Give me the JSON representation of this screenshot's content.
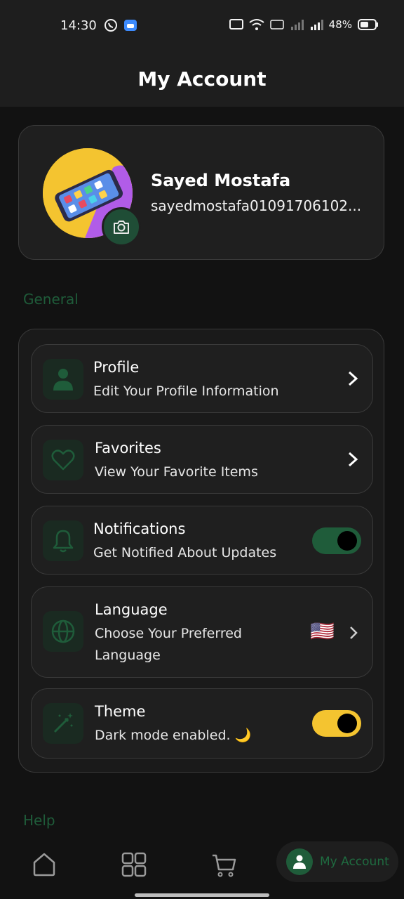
{
  "status_bar": {
    "time": "14:30",
    "battery": "48%"
  },
  "header": {
    "title": "My Account"
  },
  "profile": {
    "name": "Sayed Mostafa",
    "email": "sayedmostafa01091706102..."
  },
  "sections": {
    "general": "General",
    "help": "Help"
  },
  "settings": [
    {
      "title": "Profile",
      "subtitle": "Edit Your Profile Information",
      "icon": "person-icon",
      "control": "chevron"
    },
    {
      "title": "Favorites",
      "subtitle": "View Your Favorite Items",
      "icon": "heart-icon",
      "control": "chevron"
    },
    {
      "title": "Notifications",
      "subtitle": "Get Notified About Updates",
      "icon": "bell-icon",
      "control": "toggle",
      "toggle_on": true,
      "toggle_color": "#1f5c3a"
    },
    {
      "title": "Language",
      "subtitle": "Choose Your Preferred Language",
      "icon": "globe-icon",
      "control": "flag-chevron",
      "flag": "🇺🇸"
    },
    {
      "title": "Theme",
      "subtitle": "Dark mode enabled. 🌙",
      "icon": "magic-wand-icon",
      "control": "toggle",
      "toggle_on": true,
      "toggle_color": "#f4c430"
    }
  ],
  "bottom_nav": {
    "items": [
      "home-icon",
      "grid-icon",
      "cart-icon"
    ],
    "active_label": "My Account"
  },
  "colors": {
    "accent_green": "#1f5c3a",
    "accent_yellow": "#f4c430",
    "background": "#121212"
  }
}
